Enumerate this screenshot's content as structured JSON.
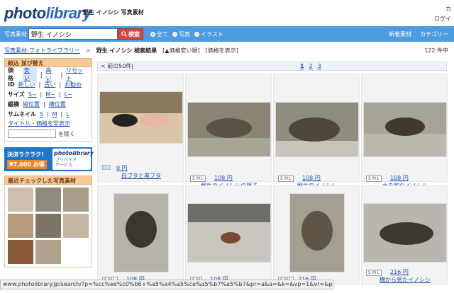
{
  "header": {
    "logo_photo": "photo",
    "logo_library": "library",
    "tagline": "野生 イノシシ 写真素材",
    "right_top": "カ",
    "right_login": "ログイ"
  },
  "search": {
    "label": "写真素材",
    "query": "野生 イノシシ",
    "button": "検索",
    "radios": [
      {
        "label": "全て",
        "checked": true
      },
      {
        "label": "写真",
        "checked": false
      },
      {
        "label": "イラスト",
        "checked": false
      }
    ],
    "right_links": [
      "新着素材",
      "カテゴリー"
    ]
  },
  "breadcrumb": {
    "home": "写真素材-フォトライブラリー",
    "sep": ">",
    "current": "野生 イノシシ 検索結果",
    "sort": "[▲価格安い順]",
    "show_price": "[価格を表示]",
    "count": "122 件中"
  },
  "sidebar": {
    "narrow_head": "絞込 並び替え",
    "price_label": "価格",
    "price_opts": [
      "安い",
      "高い",
      "リセット"
    ],
    "id_label": "ID",
    "id_opts": [
      "新しい",
      "古い",
      "お勧め"
    ],
    "size_label": "サイズ",
    "size_opts": [
      "S~",
      "M~",
      "L~"
    ],
    "orient_label": "縦横",
    "orient_opts": [
      "縦位置",
      "横位置"
    ],
    "thumb_label": "サムネイル",
    "thumb_opts": [
      "S",
      "M",
      "L"
    ],
    "hide_note": "タイトル・価格を非表示",
    "minus_label": "を除く",
    "banner_text1": "決済ラクラク!",
    "banner_text2": "¥7,000 お得",
    "banner_logo": "photolibrary",
    "banner_sub1": "プリペイド",
    "banner_sub2": "サービス",
    "recent_head": "最近チェックした写真素材"
  },
  "results": {
    "prev": "< 前の50件|",
    "pages": [
      "1",
      "2",
      "3"
    ],
    "items": [
      {
        "price": "0 円",
        "title": "白ブタと黒ブタ",
        "badge": "",
        "color": "#d9c7a8"
      },
      {
        "price": "108 円",
        "title": "野生のイノシシの親子",
        "badge": "S M L",
        "color": "#8a8474"
      },
      {
        "price": "108 円",
        "title": "野生のイノシシ",
        "badge": "S M L",
        "color": "#908c80"
      },
      {
        "price": "108 円",
        "title": "水を飲むイノシシ",
        "badge": "S M L",
        "color": "#a8a49a"
      },
      {
        "price": "108 円",
        "title": "",
        "badge": "S M L",
        "color": "#b5b3aa"
      },
      {
        "price": "108 円",
        "title": "",
        "badge": "S M",
        "color": "#c9c6c0"
      },
      {
        "price": "216 円",
        "title": "",
        "badge": "S M L",
        "color": "#a39f93"
      },
      {
        "price": "216 円",
        "title": "横から見たイノシシ",
        "badge": "S M L",
        "color": "#b8b6ae"
      }
    ]
  },
  "status_url": "www.photolibrary.jp/search/?p=%cc%ee%c0%b6+%a5%a4%a5%ce%a5%b7%a5%b7&pr=a&a=&k=&vp=1&vr=&pm=&cat=&sya=&minus="
}
